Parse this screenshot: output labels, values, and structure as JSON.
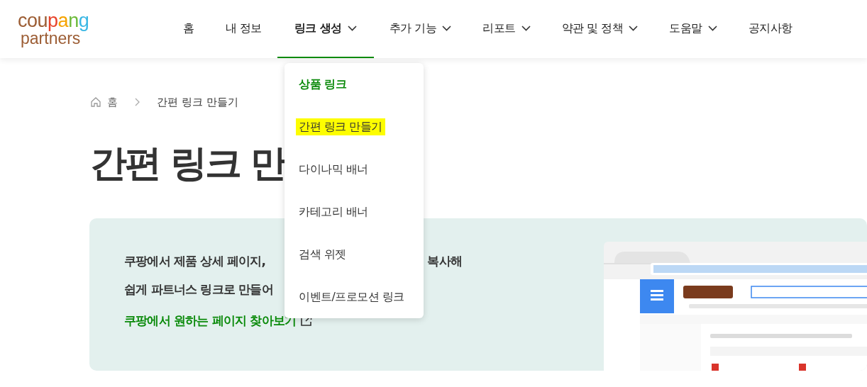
{
  "logo": {
    "word": "coupang",
    "sub": "partners"
  },
  "nav": [
    {
      "label": "홈",
      "dropdown": false,
      "selected": false
    },
    {
      "label": "내 정보",
      "dropdown": false,
      "selected": false
    },
    {
      "label": "링크 생성",
      "dropdown": true,
      "selected": true
    },
    {
      "label": "추가 기능",
      "dropdown": true,
      "selected": false
    },
    {
      "label": "리포트",
      "dropdown": true,
      "selected": false
    },
    {
      "label": "약관 및 정책",
      "dropdown": true,
      "selected": false
    },
    {
      "label": "도움말",
      "dropdown": true,
      "selected": false
    },
    {
      "label": "공지사항",
      "dropdown": false,
      "selected": false
    }
  ],
  "dropdown_menu": [
    {
      "label": "상품 링크",
      "kind": "heading",
      "highlighted": false
    },
    {
      "label": "간편 링크 만들기",
      "kind": "item",
      "highlighted": true
    },
    {
      "label": "다이나믹 배너",
      "kind": "item",
      "highlighted": false
    },
    {
      "label": "카테고리 배너",
      "kind": "item",
      "highlighted": false
    },
    {
      "label": "검색 위젯",
      "kind": "item",
      "highlighted": false
    },
    {
      "label": "이벤트/프로모션 링크",
      "kind": "item",
      "highlighted": false
    }
  ],
  "breadcrumb": [
    "홈",
    "간편 링크 만들기"
  ],
  "page_title": "간편 링크 만",
  "intro_card": {
    "line_1_start": "쿠팡에서 제품 상세 페이지,",
    "line_1_end": "복사해",
    "line_2": "쉽게 파트너스 링크로 만들어",
    "link": "쿠팡에서 원하는 페이지 찾아보기"
  }
}
